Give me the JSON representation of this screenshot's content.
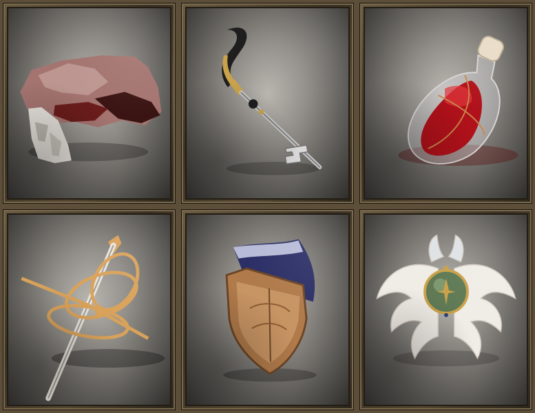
{
  "inventory": {
    "items": [
      {
        "slot": 1,
        "icon": "torn-cloth-icon",
        "colors": {
          "primary": "#7a2a28",
          "secondary": "#e6e2dc"
        }
      },
      {
        "slot": 2,
        "icon": "ornate-key-icon",
        "colors": {
          "primary": "#c9c9c9",
          "secondary": "#1e1e1e",
          "accent": "#c9a24a"
        }
      },
      {
        "slot": 3,
        "icon": "blood-bottle-icon",
        "colors": {
          "primary": "#b0111a",
          "secondary": "#e8dcc6"
        }
      },
      {
        "slot": 4,
        "icon": "rapier-hilt-icon",
        "colors": {
          "primary": "#d9a25a",
          "secondary": "#e8e4dc"
        }
      },
      {
        "slot": 5,
        "icon": "cloth-covered-shield-icon",
        "colors": {
          "primary": "#b07a4a",
          "secondary": "#2b2f66"
        }
      },
      {
        "slot": 6,
        "icon": "winged-orb-icon",
        "colors": {
          "primary": "#f0ece6",
          "secondary": "#5f7a55",
          "accent": "#c9a24a"
        }
      }
    ]
  }
}
